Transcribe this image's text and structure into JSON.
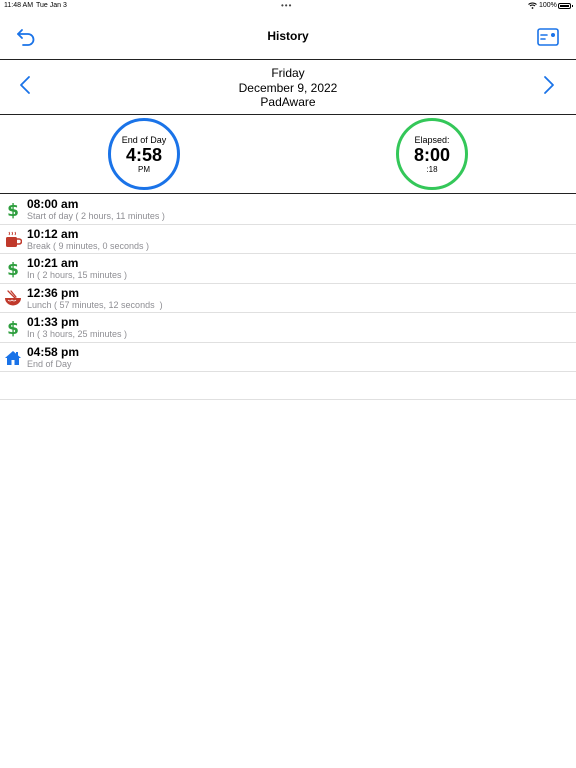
{
  "status_bar": {
    "time": "11:48 AM",
    "date": "Tue Jan 3",
    "dots": "•••",
    "battery": "100%"
  },
  "nav": {
    "title": "History",
    "back_icon": "undo-arrow-icon",
    "card_icon": "card-icon"
  },
  "date_header": {
    "weekday": "Friday",
    "date": "December 9, 2022",
    "name": "PadAware"
  },
  "summary": {
    "end_of_day": {
      "label": "End of Day",
      "time": "4:58",
      "suffix": "PM",
      "color": "#1a73e8"
    },
    "elapsed": {
      "label": "Elapsed:",
      "time": "8:00",
      "suffix": ":18",
      "color": "#34c759"
    }
  },
  "entries": [
    {
      "icon": "dollar-icon",
      "time": "08:00 am",
      "desc": "Start of day ( 2 hours, 11 minutes )"
    },
    {
      "icon": "coffee-cup-icon",
      "time": "10:12 am",
      "desc": "Break ( 9 minutes, 0 seconds )"
    },
    {
      "icon": "dollar-icon",
      "time": "10:21 am",
      "desc": "In ( 2 hours, 15 minutes )"
    },
    {
      "icon": "noodle-bowl-icon",
      "time": "12:36 pm",
      "desc": "Lunch ( 57 minutes, 12 seconds  )"
    },
    {
      "icon": "dollar-icon",
      "time": "01:33 pm",
      "desc": "In ( 3 hours, 25 minutes )"
    },
    {
      "icon": "home-icon",
      "time": "04:58 pm",
      "desc": "End of Day"
    }
  ]
}
